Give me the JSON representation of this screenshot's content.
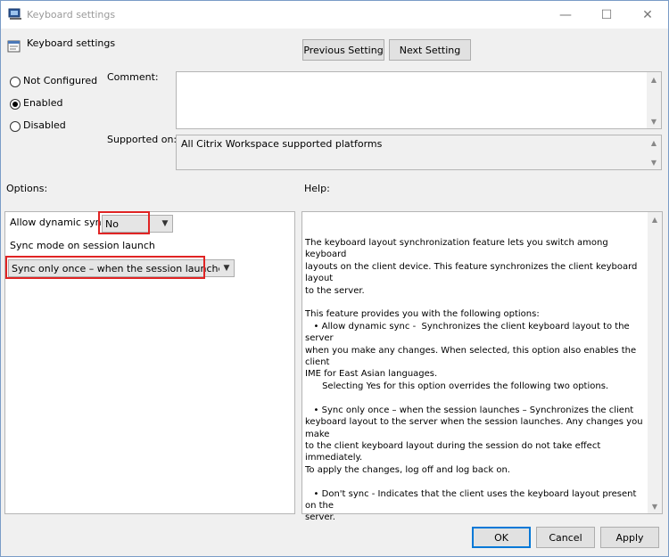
{
  "window": {
    "title": "Keyboard settings",
    "minimize_glyph": "—",
    "maximize_glyph": "☐",
    "close_glyph": "✕"
  },
  "header": {
    "setting_name": "Keyboard settings",
    "previous_label": "Previous Setting",
    "next_label": "Next Setting"
  },
  "state": {
    "not_configured_label": "Not Configured",
    "enabled_label": "Enabled",
    "disabled_label": "Disabled",
    "selected": "Enabled"
  },
  "comment": {
    "label": "Comment:",
    "value": ""
  },
  "supported": {
    "label": "Supported on:",
    "value": "All Citrix Workspace supported platforms"
  },
  "options": {
    "label": "Options:",
    "allow_dynamic_sync_label": "Allow dynamic sync",
    "allow_dynamic_sync_value": "No",
    "sync_mode_label": "Sync mode on session launch",
    "sync_mode_value": "Sync only once – when the session launches"
  },
  "help": {
    "label": "Help:",
    "text": "The keyboard layout synchronization feature lets you switch among keyboard\nlayouts on the client device. This feature synchronizes the client keyboard layout\nto the server.\n\nThis feature provides you with the following options:\n   • Allow dynamic sync -  Synchronizes the client keyboard layout to the server\nwhen you make any changes. When selected, this option also enables the client\nIME for East Asian languages.\n      Selecting Yes for this option overrides the following two options.\n\n   • Sync only once – when the session launches – Synchronizes the client\nkeyboard layout to the server when the session launches. Any changes you make\nto the client keyboard layout during the session do not take effect immediately.\nTo apply the changes, log off and log back on.\n\n   • Don't sync - Indicates that the client uses the keyboard layout present on the\nserver."
  },
  "footer": {
    "ok_label": "OK",
    "cancel_label": "Cancel",
    "apply_label": "Apply"
  },
  "colors": {
    "highlight": "#e02424",
    "accent": "#0078d7"
  }
}
